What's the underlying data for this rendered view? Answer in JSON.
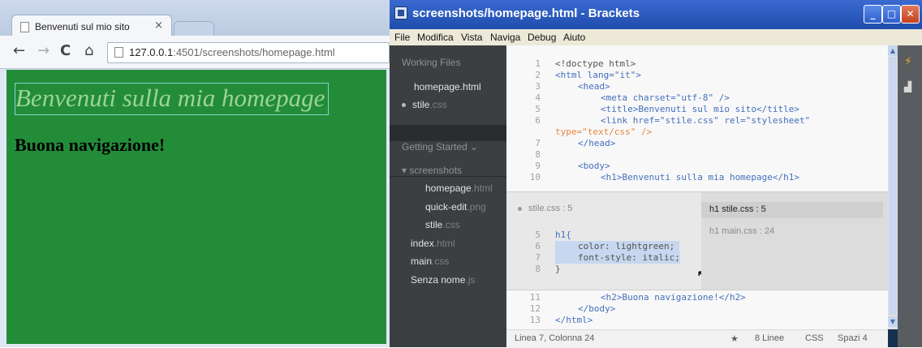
{
  "browser": {
    "tab_title": "Benvenuti sul mio sito",
    "tab_close": "×",
    "url_host": "127.0.0.1",
    "url_rest": ":4501/screenshots/homepage.html",
    "nav": {
      "back": "←",
      "forward": "→",
      "reload": "C",
      "home": "⌂"
    },
    "page": {
      "h1": "Benvenuti sulla mia homepage",
      "h2": "Buona navigazione!"
    }
  },
  "brackets": {
    "window_title": "screenshots/homepage.html - Brackets",
    "window_buttons": {
      "minimize": "_",
      "maximize": "□",
      "close": "✕"
    },
    "menu": [
      "File",
      "Modifica",
      "Vista",
      "Naviga",
      "Debug",
      "Aiuto"
    ],
    "sidebar": {
      "working_files_header": "Working Files",
      "working_files": [
        {
          "name": "homepage.html",
          "ext": ""
        },
        {
          "name": "stile",
          "ext": ".css"
        }
      ],
      "project_header": "Getting Started ⌄",
      "folder": "▾ screenshots",
      "folder_files": [
        {
          "name": "homepage",
          "ext": ".html"
        },
        {
          "name": "quick-edit",
          "ext": ".png"
        },
        {
          "name": "stile",
          "ext": ".css"
        }
      ],
      "root_files": [
        {
          "name": "index",
          "ext": ".html"
        },
        {
          "name": "main",
          "ext": ".css"
        },
        {
          "name": "Senza nome",
          "ext": ".js"
        }
      ]
    },
    "inline_editor": {
      "file": "stile.css : 5",
      "rules": [
        "h1 stile.css : 5",
        "h1 main.css : 24"
      ]
    },
    "status": {
      "position": "Linea 7, Colonna 24",
      "star": "★",
      "lines": "8 Linee",
      "mode": "CSS",
      "indent": "Spazi 4"
    },
    "scroll_up": "▲",
    "scroll_down": "▼",
    "icons": {
      "live_preview": "live-preview-icon",
      "extensions": "extension-manager-icon"
    },
    "code_lines": [
      {
        "n": "1",
        "t": "<!doctype html>"
      },
      {
        "n": "2",
        "t": "<html lang=\"it\">"
      },
      {
        "n": "3",
        "t": "<head>"
      },
      {
        "n": "4",
        "t": "<meta charset=\"utf-8\" />"
      },
      {
        "n": "5",
        "t": "<title>Benvenuti sul mio sito</title>"
      },
      {
        "n": "6",
        "t": "<link href=\"stile.css\" rel=\"stylesheet\""
      },
      {
        "n": "",
        "t": "type=\"text/css\" />"
      },
      {
        "n": "7",
        "t": "</head>"
      },
      {
        "n": "8",
        "t": ""
      },
      {
        "n": "9",
        "t": "<body>"
      },
      {
        "n": "10",
        "t": "<h1>Benvenuti sulla mia homepage</h1>"
      }
    ],
    "css_lines": [
      {
        "n": "5",
        "t": "h1{"
      },
      {
        "n": "6",
        "t": "color: lightgreen;"
      },
      {
        "n": "7",
        "t": "font-style: italic;"
      },
      {
        "n": "8",
        "t": "}"
      }
    ],
    "code_lines_after": [
      {
        "n": "11",
        "t": "<h2>Buona navigazione!</h2>"
      },
      {
        "n": "12",
        "t": "</body>"
      },
      {
        "n": "13",
        "t": "</html>"
      }
    ]
  }
}
